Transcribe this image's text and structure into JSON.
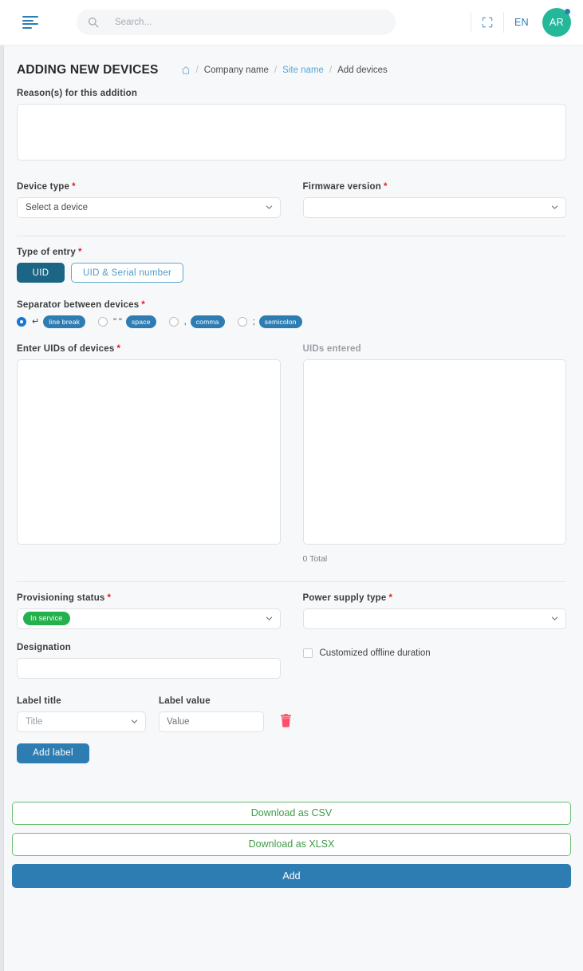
{
  "topbar": {
    "menu_icon": "hamburger-menu-icon",
    "search_placeholder": "Search...",
    "search_value": "",
    "fullscreen_icon": "fullscreen-icon",
    "language": "EN",
    "avatar_initials": "AR"
  },
  "page": {
    "title": "ADDING NEW DEVICES",
    "breadcrumb": {
      "home_icon": "home-icon",
      "separator": "/",
      "items": [
        {
          "label": "Company name",
          "link": false
        },
        {
          "label": "Site name",
          "link": true
        },
        {
          "label": "Add devices",
          "link": false
        }
      ]
    }
  },
  "form": {
    "reason": {
      "label": "Reason(s) for this addition",
      "value": ""
    },
    "device_type": {
      "label": "Device type",
      "required": true,
      "value": "Select a device"
    },
    "firmware_version": {
      "label": "Firmware version",
      "required": true,
      "value": ""
    },
    "type_of_entry": {
      "label": "Type of entry",
      "required": true,
      "options": [
        {
          "label": "UID",
          "selected": true
        },
        {
          "label": "UID & Serial number",
          "selected": false
        }
      ]
    },
    "separator": {
      "label": "Separator between devices",
      "required": true,
      "options": [
        {
          "symbol": "↵",
          "chip": "line break",
          "selected": true
        },
        {
          "symbol": "\" \"",
          "chip": "space",
          "selected": false
        },
        {
          "symbol": ",",
          "chip": "comma",
          "selected": false
        },
        {
          "symbol": ";",
          "chip": "semicolon",
          "selected": false
        }
      ]
    },
    "enter_uids": {
      "label": "Enter UIDs of devices",
      "required": true,
      "value": ""
    },
    "uids_entered": {
      "label": "UIDs entered",
      "value": "",
      "total": "0 Total"
    },
    "provisioning_status": {
      "label": "Provisioning status",
      "required": true,
      "badge": "In service"
    },
    "power_supply_type": {
      "label": "Power supply type",
      "required": true,
      "value": ""
    },
    "designation": {
      "label": "Designation",
      "value": ""
    },
    "customized_offline_duration": {
      "label": "Customized offline duration",
      "checked": false
    },
    "label_title": {
      "label": "Label title",
      "placeholder": "Title",
      "value": ""
    },
    "label_value": {
      "label": "Label value",
      "placeholder": "Value",
      "value": ""
    },
    "delete_label_icon": "trash-icon",
    "add_label_button": "Add label"
  },
  "actions": {
    "download_csv": "Download as CSV",
    "download_xlsx": "Download as XLSX",
    "submit": "Add"
  },
  "colors": {
    "primary": "#2e7db2",
    "primary_dark": "#1b6585",
    "accent_green": "#22b14c",
    "outline_green": "#6dbf73",
    "danger": "#ff4d6a",
    "required": "#e8192c",
    "avatar": "#25b79a",
    "page_bg": "#f7f8f9"
  }
}
